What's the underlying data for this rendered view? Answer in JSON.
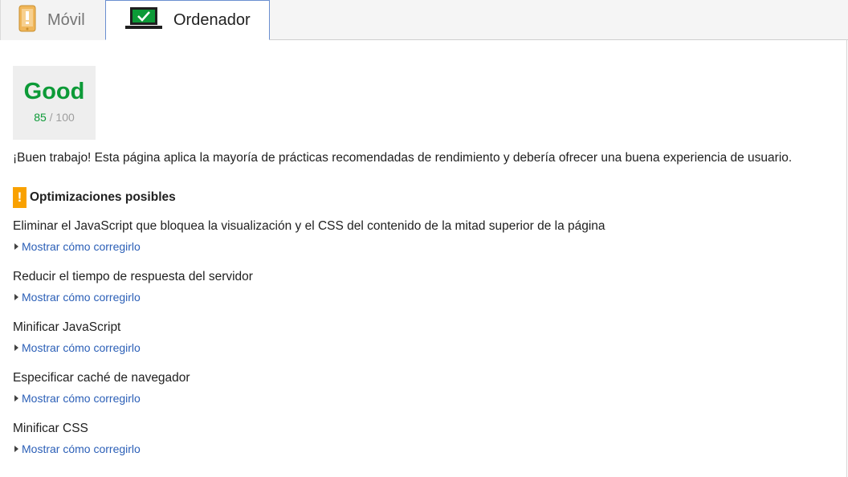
{
  "tabs": {
    "mobile": {
      "label": "Móvil",
      "icon": "phone-warning-icon"
    },
    "desktop": {
      "label": "Ordenador",
      "icon": "laptop-check-icon"
    }
  },
  "score": {
    "verdict": "Good",
    "value": "85",
    "max": "/ 100",
    "color": "#0c9a37"
  },
  "summary": "¡Buen trabajo! Esta página aplica la mayoría de prácticas recomendadas de rendimiento y debería ofrecer una buena experiencia de usuario.",
  "optimizations": {
    "title": "Optimizaciones posibles",
    "icon": "warning-icon",
    "icon_glyph": "!",
    "accent": "#f9a100",
    "items": [
      {
        "title": "Eliminar el JavaScript que bloquea la visualización y el CSS del contenido de la mitad superior de la página",
        "link": "Mostrar cómo corregirlo"
      },
      {
        "title": "Reducir el tiempo de respuesta del servidor",
        "link": "Mostrar cómo corregirlo"
      },
      {
        "title": "Minificar JavaScript",
        "link": "Mostrar cómo corregirlo"
      },
      {
        "title": "Especificar caché de navegador",
        "link": "Mostrar cómo corregirlo"
      },
      {
        "title": "Minificar CSS",
        "link": "Mostrar cómo corregirlo"
      }
    ]
  }
}
